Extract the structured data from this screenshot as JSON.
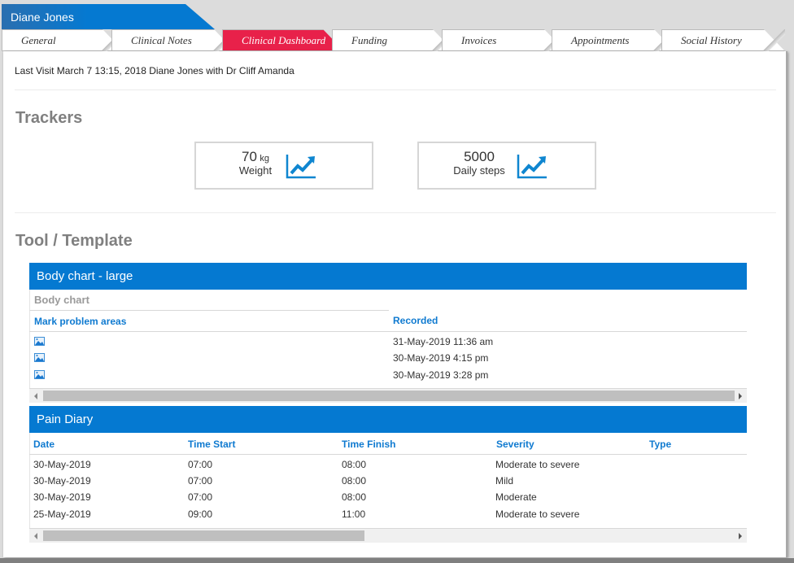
{
  "patient": {
    "name": "Diane Jones"
  },
  "tabs": [
    {
      "label": "General",
      "active": false
    },
    {
      "label": "Clinical Notes",
      "active": false
    },
    {
      "label": "Clinical Dashboard",
      "active": true
    },
    {
      "label": "Funding",
      "active": false
    },
    {
      "label": "Invoices",
      "active": false
    },
    {
      "label": "Appointments",
      "active": false
    },
    {
      "label": "Social History",
      "active": false
    }
  ],
  "last_visit": "Last Visit March 7 13:15, 2018 Diane Jones with Dr Cliff Amanda",
  "trackers": {
    "title": "Trackers",
    "items": [
      {
        "value": "70",
        "unit": "kg",
        "label": "Weight",
        "icon": "trend-chart-icon"
      },
      {
        "value": "5000",
        "unit": "",
        "label": "Daily steps",
        "icon": "trend-chart-icon"
      }
    ]
  },
  "tools": {
    "title": "Tool / Template",
    "body_chart": {
      "header": "Body chart - large",
      "subheader": "Body chart",
      "columns": [
        "Mark problem areas",
        "Recorded"
      ],
      "rows": [
        {
          "icon": "image-icon",
          "recorded": "31-May-2019 11:36 am"
        },
        {
          "icon": "image-icon",
          "recorded": "30-May-2019 4:15 pm"
        },
        {
          "icon": "image-icon",
          "recorded": "30-May-2019 3:28 pm"
        }
      ]
    },
    "pain_diary": {
      "header": "Pain Diary",
      "columns": [
        "Date",
        "Time Start",
        "Time Finish",
        "Severity",
        "Type"
      ],
      "rows": [
        [
          "30-May-2019",
          "07:00",
          "08:00",
          "Moderate to severe",
          ""
        ],
        [
          "30-May-2019",
          "07:00",
          "08:00",
          "Mild",
          ""
        ],
        [
          "30-May-2019",
          "07:00",
          "08:00",
          "Moderate",
          ""
        ],
        [
          "25-May-2019",
          "09:00",
          "11:00",
          "Moderate to severe",
          ""
        ]
      ]
    }
  },
  "colors": {
    "brand_blue": "#0579d1",
    "active_tab": "#e8214a",
    "header_link": "#0f7ad0",
    "section_gray": "#808080"
  }
}
